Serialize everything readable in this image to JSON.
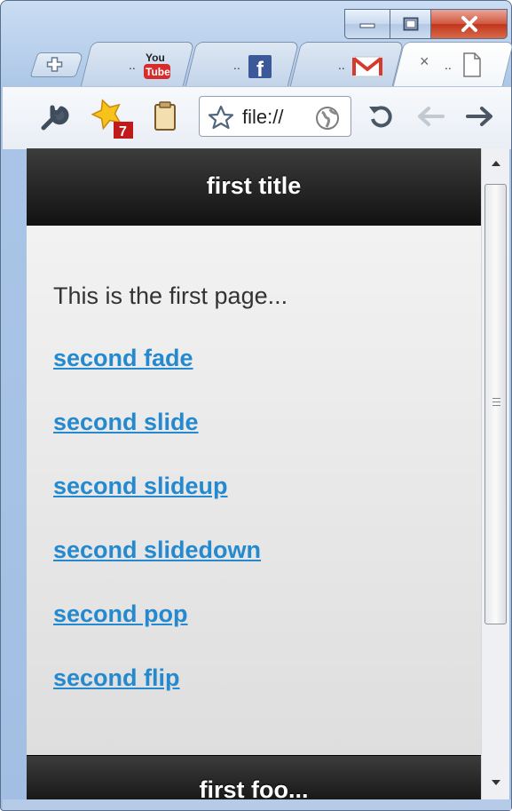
{
  "tabs": [
    {
      "ellipsis": "..",
      "icon": "youtube-icon",
      "icon_text_top": "You",
      "icon_text_bottom": "Tube"
    },
    {
      "ellipsis": "..",
      "icon": "facebook-icon",
      "icon_text": "f"
    },
    {
      "ellipsis": "..",
      "icon": "gmail-icon"
    },
    {
      "close": "×",
      "ellipsis": "..",
      "icon": "page-icon",
      "active": true
    }
  ],
  "toolbar": {
    "badge_count": "7",
    "address_text": "file://"
  },
  "page": {
    "header_title": "first title",
    "intro": "This is the first page...",
    "links": [
      "second fade",
      "second slide",
      "second slideup",
      "second slidedown",
      "second pop",
      "second flip"
    ],
    "footer_title": "first foo..."
  },
  "colors": {
    "link": "#2489ce",
    "bar": "#1e1e1e",
    "content_bg": "#e9e9e9"
  }
}
